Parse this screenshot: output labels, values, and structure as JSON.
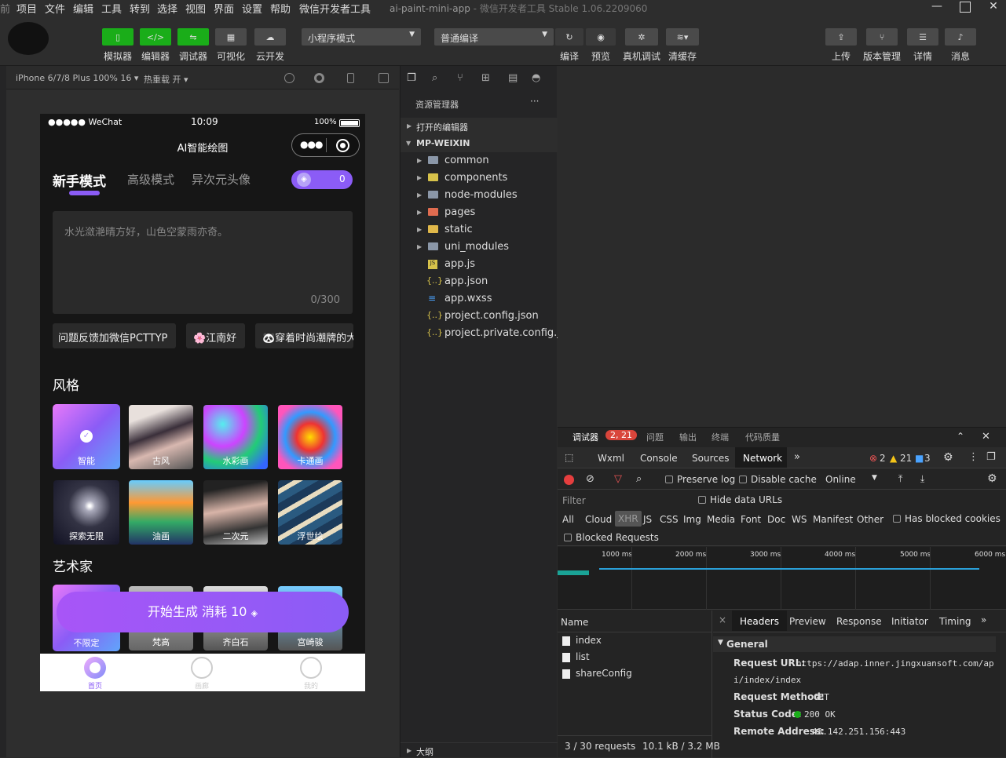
{
  "menubar": {
    "items": [
      "项目",
      "文件",
      "编辑",
      "工具",
      "转到",
      "选择",
      "视图",
      "界面",
      "设置",
      "帮助",
      "微信开发者工具"
    ],
    "app_name": "ai-paint-mini-app",
    "app_subtitle": "- 微信开发者工具 Stable 1.06.2209060"
  },
  "toolbar": {
    "simulator": "模拟器",
    "editor": "编辑器",
    "debugger": "调试器",
    "visual": "可视化",
    "cloud": "云开发",
    "mode_select": "小程序模式",
    "compile_select": "普通编译",
    "compile": "编译",
    "preview": "预览",
    "real_debug": "真机调试",
    "clear_cache": "清缓存",
    "upload": "上传",
    "version": "版本管理",
    "details": "详情",
    "messages": "消息"
  },
  "simulator_bar": {
    "device": "iPhone 6/7/8 Plus 100% 16 ▾",
    "hot_reload": "热重载 开 ▾"
  },
  "phone": {
    "status": {
      "carrier": "●●●●● WeChat",
      "time": "10:09",
      "battery": "100%"
    },
    "nav_title": "AI智能绘图",
    "tabs": [
      "新手模式",
      "高级模式",
      "异次元头像"
    ],
    "points": "0",
    "prompt_placeholder": "水光潋滟晴方好，山色空蒙雨亦奇。",
    "counter": "0/300",
    "chips": [
      "问题反馈加微信PCTTYP",
      "🌸江南好",
      "🐼穿着时尚潮牌的大"
    ],
    "style_title": "风格",
    "styles": [
      "智能",
      "古风",
      "水彩画",
      "卡通画",
      "探索无限",
      "油画",
      "二次元",
      "浮世绘"
    ],
    "artist_title": "艺术家",
    "artists": [
      "不限定",
      "梵高",
      "齐白石",
      "宫崎骏"
    ],
    "generate_btn": "开始生成  消耗 10",
    "tabbar": [
      "首页",
      "画廊",
      "我的"
    ]
  },
  "filepanel": {
    "title": "资源管理器",
    "more": "···",
    "open_editors": "打开的编辑器",
    "root": "MP-WEIXIN",
    "folders": [
      "common",
      "components",
      "node-modules",
      "pages",
      "static",
      "uni_modules"
    ],
    "files": [
      "app.js",
      "app.json",
      "app.wxss",
      "project.config.json",
      "project.private.config.js..."
    ],
    "outline": "大纲"
  },
  "devtools": {
    "top_tabs": [
      "调试器",
      "问题",
      "输出",
      "终端",
      "代码质量"
    ],
    "badge": "2, 21",
    "panel_tabs": [
      "Wxml",
      "Console",
      "Sources",
      "Network"
    ],
    "errors": "2",
    "warnings": "21",
    "infos": "3",
    "preserve_log": "Preserve log",
    "disable_cache": "Disable cache",
    "throttle": "Online",
    "filter": "Filter",
    "hide_data_urls": "Hide data URLs",
    "types": [
      "All",
      "Cloud",
      "XHR",
      "JS",
      "CSS",
      "Img",
      "Media",
      "Font",
      "Doc",
      "WS",
      "Manifest",
      "Other"
    ],
    "has_blocked": "Has blocked cookies",
    "blocked_requests": "Blocked Requests",
    "timeline": [
      "1000 ms",
      "2000 ms",
      "3000 ms",
      "4000 ms",
      "5000 ms",
      "6000 ms"
    ],
    "name_header": "Name",
    "requests": [
      "index",
      "list",
      "shareConfig"
    ],
    "detail_tabs": [
      "Headers",
      "Preview",
      "Response",
      "Initiator",
      "Timing"
    ],
    "general": "General",
    "request_url_label": "Request URL:",
    "request_url_1": "https://adap.inner.jingxuansoft.com/ap",
    "request_url_2": "i/index/index",
    "method_label": "Request Method:",
    "method": "GET",
    "status_label": "Status Code:",
    "status": "200 OK",
    "remote_label": "Remote Address:",
    "remote": "43.142.251.156:443",
    "summary_requests": "3 / 30 requests",
    "summary_size": "10.1 kB / 3.2 MB"
  }
}
